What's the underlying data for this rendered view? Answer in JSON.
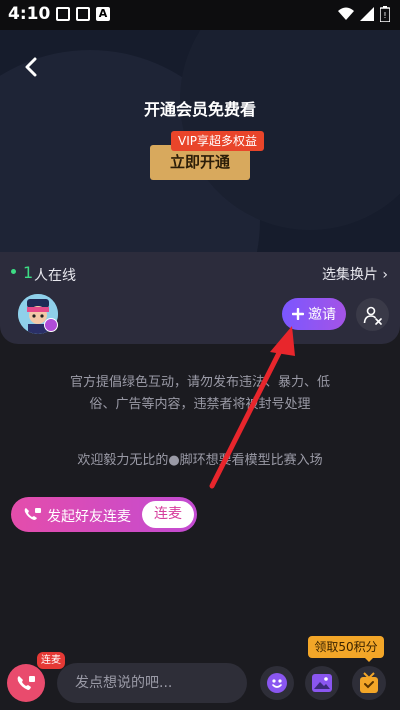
{
  "status_bar": {
    "time": "4:10",
    "app_icons": [
      "tv-icon",
      "tv-icon",
      "a-icon"
    ]
  },
  "video": {
    "title": "开通会员免费看",
    "vip_badge": "VIP享超多权益",
    "vip_button": "立即开通"
  },
  "room": {
    "online_count": "1",
    "online_label": "人在线",
    "episode_link": "选集换片 ›",
    "invite_label": "邀请"
  },
  "notice": "官方提倡绿色互动，请勿发布违法、暴力、低俗、广告等内容，违禁者将被封号处理",
  "welcome": "欢迎毅力无比的●脚环想要看模型比赛入场",
  "call_pill": {
    "label": "发起好友连麦",
    "action": "连麦"
  },
  "points_tag": "领取50积分",
  "bottom_bar": {
    "mic_badge": "连麦",
    "input_placeholder": "发点想说的吧...",
    "buttons": [
      "emoji-icon",
      "image-icon",
      "gift-box-icon"
    ]
  },
  "colors": {
    "accent_purple": "#8a56f0",
    "online_green": "#3ddc84",
    "vip_gold": "#d8a95d",
    "pink": "#e44dab",
    "orange": "#f3a628"
  }
}
